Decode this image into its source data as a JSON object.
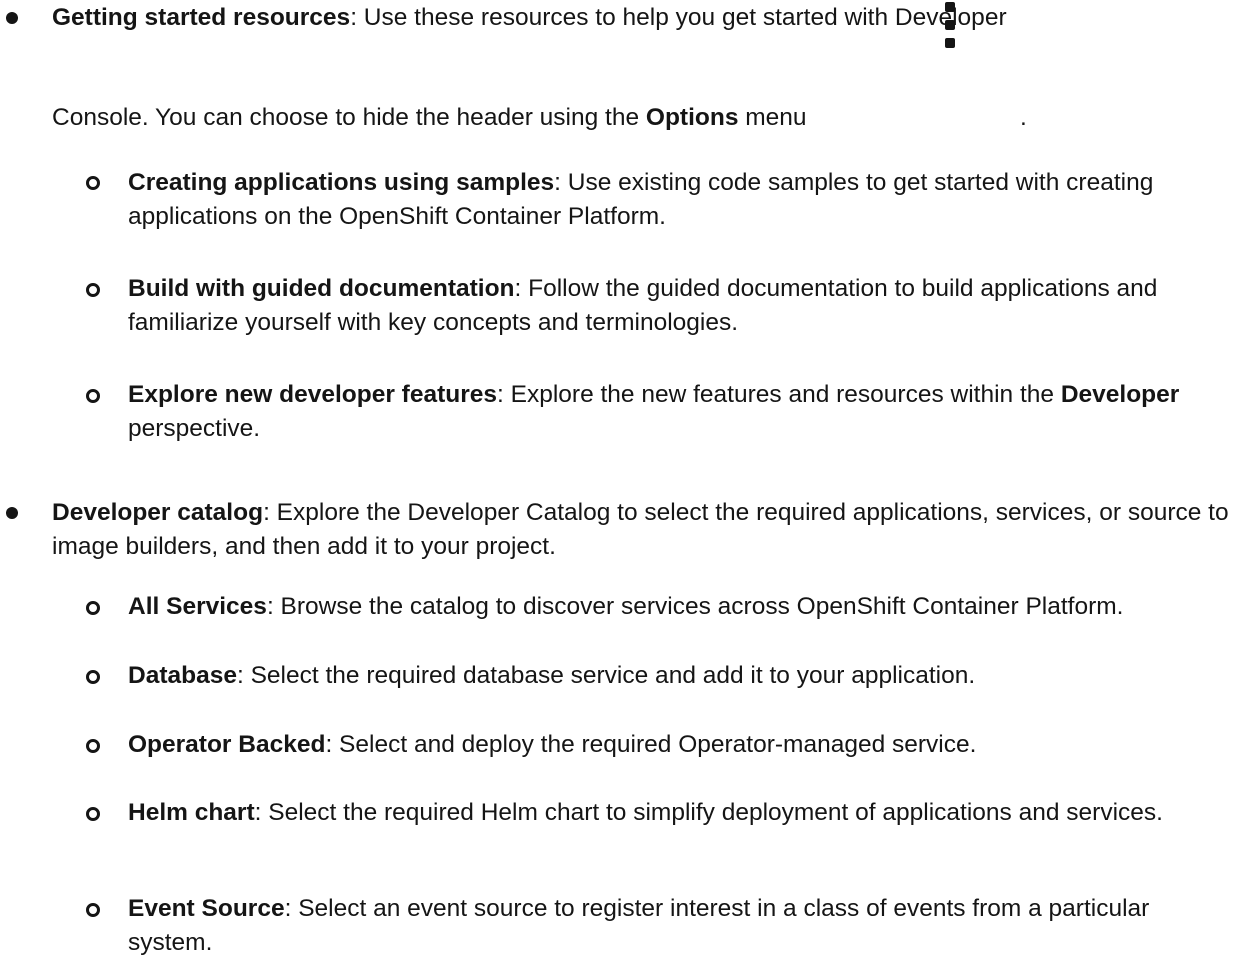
{
  "items": [
    {
      "title": "Getting started resources",
      "sep": ":",
      "text_line1": " Use these resources to help you get started with Developer",
      "text_line2_pre": "Console. You can choose to hide the header using the ",
      "options_label": "Options",
      "text_line2_post": " menu",
      "trailing_period": ".",
      "menu_icon": "kebab-vertical-icon",
      "children": [
        {
          "title": "Creating applications using samples",
          "sep": ":",
          "text": " Use existing code samples to get started with creating applications on the OpenShift Container Platform."
        },
        {
          "title": "Build with guided documentation",
          "sep": ":",
          "text": " Follow the guided documentation to build applications and familiarize yourself with key concepts and terminologies."
        },
        {
          "title": "Explore new developer features",
          "sep": ":",
          "text_pre": " Explore the new features and resources within the ",
          "emph": "Developer",
          "text_post": " perspective."
        }
      ]
    },
    {
      "title": "Developer catalog",
      "sep": ":",
      "text": " Explore the Developer Catalog to select the required applications, services, or source to image builders, and then add it to your project.",
      "children": [
        {
          "title": "All Services",
          "sep": ":",
          "text": " Browse the catalog to discover services across OpenShift Container Platform."
        },
        {
          "title": "Database",
          "sep": ":",
          "text": " Select the required database service and add it to your application."
        },
        {
          "title": "Operator Backed",
          "sep": ":",
          "text": " Select and deploy the required Operator-managed service."
        },
        {
          "title": "Helm chart",
          "sep": ":",
          "text": " Select the required Helm chart to simplify deployment of applications and services."
        },
        {
          "title": "Event Source",
          "sep": ":",
          "text": " Select an event source to register interest in a class of events from a particular system."
        }
      ]
    }
  ]
}
